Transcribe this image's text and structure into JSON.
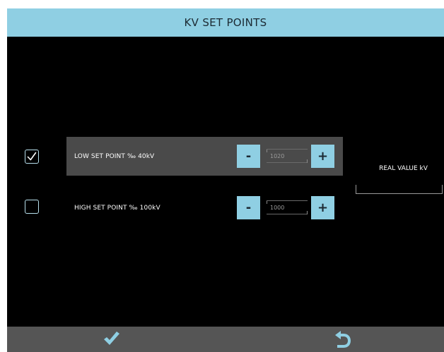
{
  "header": {
    "title": "KV SET POINTS"
  },
  "set_points": [
    {
      "checked": true,
      "label": "LOW SET POINT ‰ 40kV",
      "value": "1020",
      "minus": "-",
      "plus": "+"
    },
    {
      "checked": false,
      "label": "HIGH SET POINT ‰ 100kV",
      "value": "1000",
      "minus": "-",
      "plus": "+"
    }
  ],
  "real_value": {
    "label": "REAL VALUE kV",
    "value": ""
  },
  "footer": {
    "confirm_icon": "checkmark-icon",
    "back_icon": "undo-arrow-icon"
  },
  "colors": {
    "accent": "#8fcfe3",
    "background": "#000000",
    "selected_row": "#4a4a4a",
    "footer": "#555555",
    "footer_icon": "#8fcfe3"
  }
}
